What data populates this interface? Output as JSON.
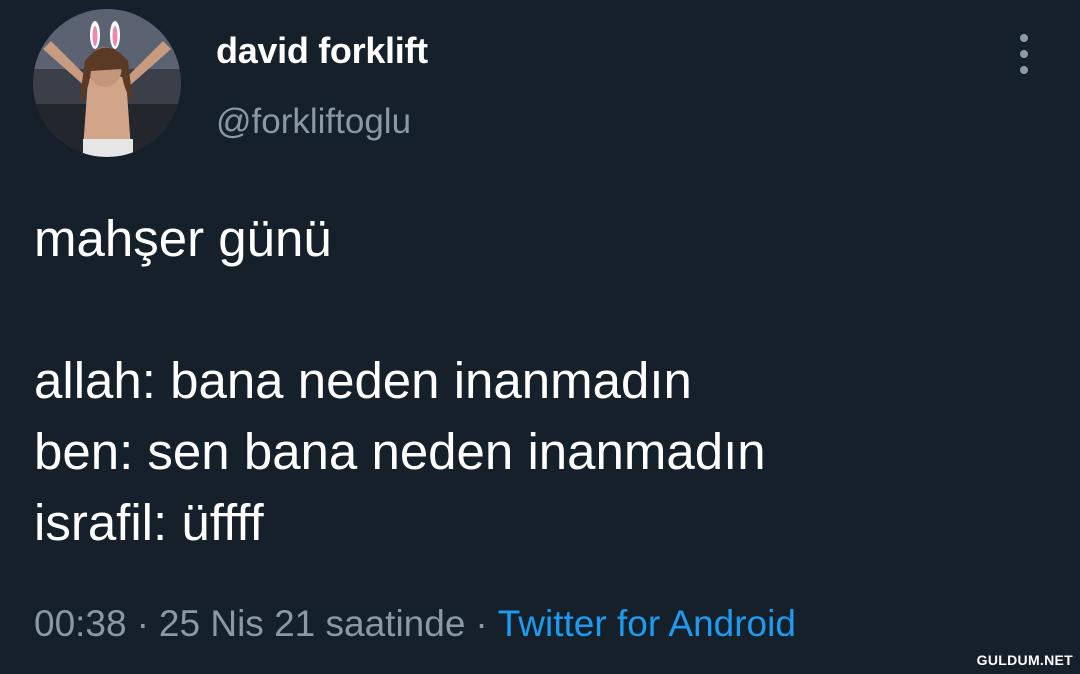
{
  "author": {
    "display_name": "david forklift",
    "handle": "@forkliftoglu"
  },
  "tweet": {
    "lines": [
      "mahşer günü",
      "",
      "allah: bana neden inanmadın",
      "ben: sen bana neden inanmadın",
      "israfil: üffff"
    ]
  },
  "meta": {
    "time": "00:38",
    "date": "25 Nis 21 saatinde",
    "separator": "·",
    "source": "Twitter for Android"
  },
  "watermark": "GULDUM.NET",
  "colors": {
    "background": "#16202b",
    "secondary_text": "#8b98a5",
    "link": "#1d9bf0"
  }
}
